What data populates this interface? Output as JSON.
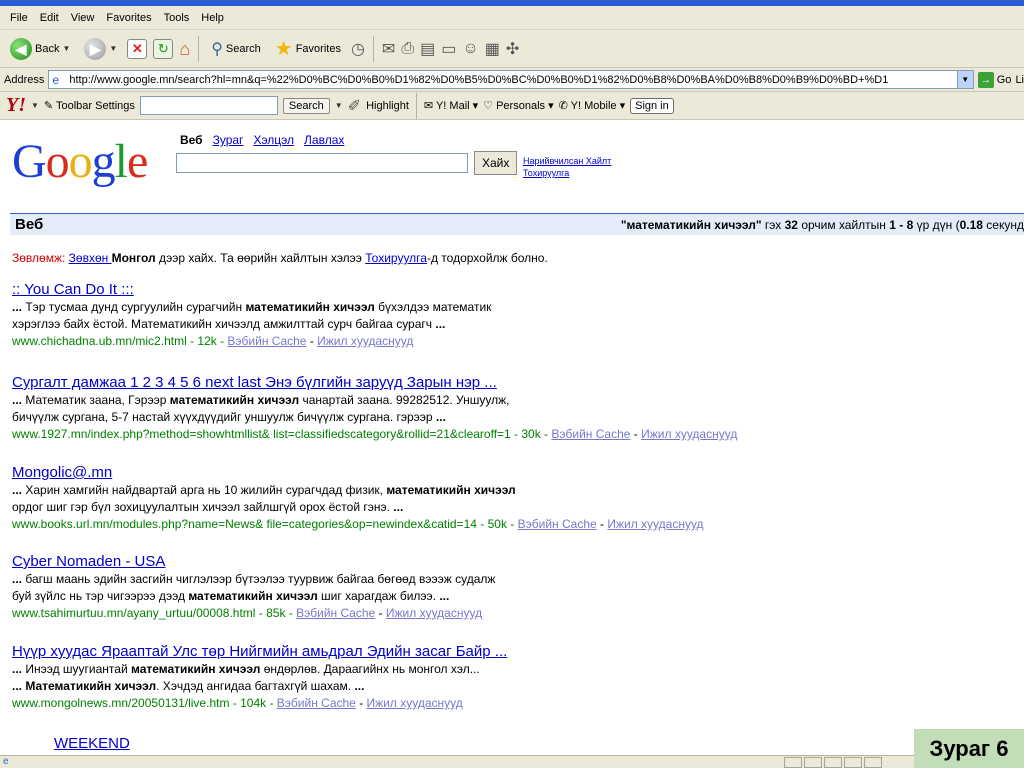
{
  "menu": [
    "File",
    "Edit",
    "View",
    "Favorites",
    "Tools",
    "Help"
  ],
  "toolbar": {
    "back": "Back",
    "search": "Search",
    "favorites": "Favorites"
  },
  "address": {
    "label": "Address",
    "url": "http://www.google.mn/search?hl=mn&q=%22%D0%BC%D0%B0%D1%82%D0%B5%D0%BC%D0%B0%D1%82%D0%B8%D0%BA%D0%B8%D0%B9%D0%BD+%D1",
    "go": "Go",
    "links": "Li"
  },
  "yahoo": {
    "logo": "Y!",
    "toolbar_settings": "Toolbar Settings",
    "search": "Search",
    "highlight": "Highlight",
    "mail": "Y! Mail",
    "personals": "Personals",
    "mobile": "Y! Mobile",
    "signin": "Sign in"
  },
  "google": {
    "tabs": [
      "Веб",
      "Зураг",
      "Хэлцэл",
      "Лавлах"
    ],
    "search_button": "Хайх",
    "advanced_search": "Нарийвчилсан Хайлт",
    "preferences": "Тохируулга"
  },
  "results_bar": {
    "label": "Веб",
    "query": "\"математикийн хичээл\"",
    "text1": " гэх ",
    "count": "32",
    "text2": " орчим хайлтын ",
    "range": "1 - 8",
    "text3": " үр дүн (",
    "time": "0.18",
    "text4": " секунд"
  },
  "tip": {
    "label": "Зөвлөмж:",
    "link": "Зөвхөн ",
    "bold": "Монгол",
    "text": " дээр хайх. Та өөрийн хайлтын хэлээ ",
    "link2": "Тохируулга",
    "tail": "-д тодорхойлж болно."
  },
  "results": [
    {
      "title": ":: You Can Do It :::",
      "lines": [
        [
          [
            "b",
            "... "
          ],
          [
            "t",
            "Тэр тусмаа дунд сургуулийн сурагчийн "
          ],
          [
            "b",
            "математикийн хичээл"
          ],
          [
            "t",
            " бүхэлдээ математик"
          ]
        ],
        [
          [
            "t",
            "хэрэглээ байх ёстой. Математикийн хичээлд амжилттай сурч байгаа сурагч "
          ],
          [
            "b",
            "..."
          ]
        ]
      ],
      "url": "www.chichadna.ub.mn/mic2.html - 12k - ",
      "cache": "Вэбийн Cache",
      "similar": "Ижил хуудаснууд"
    },
    {
      "title": "Сургалт дамжаа 1 2 3 4 5 6 next last Энэ бүлгийн заруүд Зарын нэр ...",
      "lines": [
        [
          [
            "b",
            "... "
          ],
          [
            "t",
            "Математик заана, Гэрээр "
          ],
          [
            "b",
            "математикийн хичээл"
          ],
          [
            "t",
            " чанартай заана. 99282512. Уншуулж,"
          ]
        ],
        [
          [
            "t",
            "бичүүлж сургана, 5-7 настай хүүхдүүдийг уншуулж бичүүлж сургана. гэрээр "
          ],
          [
            "b",
            "..."
          ]
        ]
      ],
      "url": "www.1927.mn/index.php?method=showhtmllist& list=classifiedscategory&rollid=21&clearoff=1 - 30k - ",
      "cache": "Вэбийн Cache",
      "similar": "Ижил хуудаснууд"
    },
    {
      "title": "Mongolic@.mn",
      "lines": [
        [
          [
            "b",
            "... "
          ],
          [
            "t",
            "Харин хамгийн найдвартай арга нь 10 жилийн сурагчдад физик, "
          ],
          [
            "b",
            "математикийн хичээл"
          ]
        ],
        [
          [
            "t",
            "ордог шиг гэр бүл зохицуулалтын хичээл зайлшгүй орох ёстой гэнэ. "
          ],
          [
            "b",
            "..."
          ]
        ]
      ],
      "url": "www.books.url.mn/modules.php?name=News& file=categories&op=newindex&catid=14 - 50k - ",
      "cache": "Вэбийн Cache",
      "similar": "Ижил хуудаснууд"
    },
    {
      "title": "Cyber Nomaden - USA",
      "lines": [
        [
          [
            "b",
            "... "
          ],
          [
            "t",
            "багш маань эдийн засгийн чиглэлээр бүтээлээ туурвиж байгаа бөгөөд вэээж судалж"
          ]
        ],
        [
          [
            "t",
            "буй зүйлс нь тэр чигээрээ дээд "
          ],
          [
            "b",
            "математикийн хичээл"
          ],
          [
            "t",
            " шиг харагдаж билээ. "
          ],
          [
            "b",
            "..."
          ]
        ]
      ],
      "url": "www.tsahimurtuu.mn/ayany_urtuu/00008.html - 85k - ",
      "cache": "Вэбийн Cache",
      "similar": "Ижил хуудаснууд"
    },
    {
      "title": "Нүүр хуудас Ярааптай Улс төр Нийгмийн амьдрал Эдийн засаг Байр ...",
      "lines": [
        [
          [
            "b",
            "... "
          ],
          [
            "t",
            "Инээд шуугиантай "
          ],
          [
            "b",
            "математикийн хичээл"
          ],
          [
            "t",
            " өндөрлөв. Дараагийнх нь монгол хэл..."
          ]
        ],
        [
          [
            "b",
            "... Математикийн хичээл"
          ],
          [
            "t",
            ". Хэчдэд ангидаа багтахгүй шахам. "
          ],
          [
            "b",
            "..."
          ]
        ]
      ],
      "url": "www.mongolnews.mn/20050131/live.htm - 104k - ",
      "cache": "Вэбийн Cache",
      "similar": "Ижил хуудаснууд"
    }
  ],
  "partial_result": "WEEKEND",
  "slide_label": "Зураг 6"
}
